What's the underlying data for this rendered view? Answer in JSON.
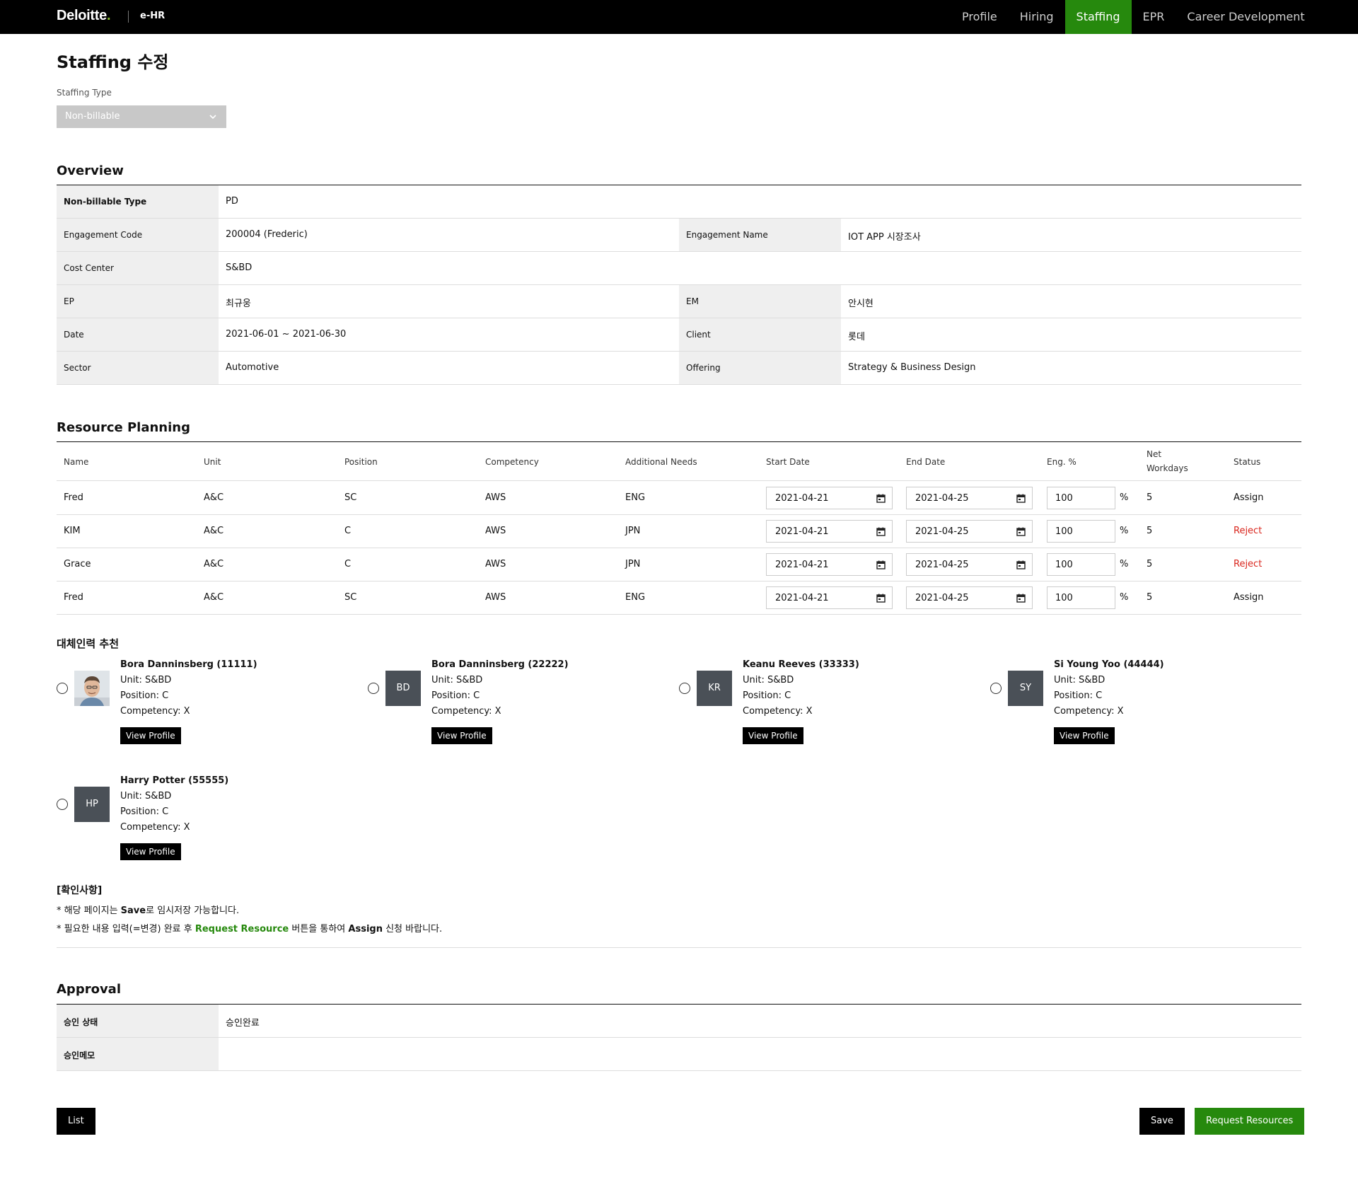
{
  "header": {
    "brand": "Deloitte",
    "brand_dot": ".",
    "sub": "e-HR",
    "nav": [
      "Profile",
      "Hiring",
      "Staffing",
      "EPR",
      "Career Development"
    ],
    "active_nav": "Staffing",
    "colors": {
      "topbar": "#000000",
      "accent": "#26890d",
      "logo_dot": "#86bc25"
    }
  },
  "page": {
    "title": "Staffing 수정",
    "staffing_type_label": "Staffing Type",
    "staffing_type_value": "Non-billable"
  },
  "overview": {
    "title": "Overview",
    "non_billable_type_label": "Non-billable Type",
    "non_billable_type_value": "PD",
    "engagement_code_label": "Engagement Code",
    "engagement_code_value": "200004 (Frederic)",
    "engagement_name_label": "Engagement Name",
    "engagement_name_value": "IOT APP 시장조사",
    "cost_center_label": "Cost Center",
    "cost_center_value": "S&BD",
    "ep_label": "EP",
    "ep_value": "최규웅",
    "em_label": "EM",
    "em_value": "안시현",
    "date_label": "Date",
    "date_value": "2021-06-01 ~ 2021-06-30",
    "client_label": "Client",
    "client_value": "롯데",
    "sector_label": "Sector",
    "sector_value": "Automotive",
    "offering_label": "Offering",
    "offering_value": "Strategy & Business Design"
  },
  "resource_planning": {
    "title": "Resource Planning",
    "columns": {
      "name": "Name",
      "unit": "Unit",
      "position": "Position",
      "competency": "Competency",
      "additional_needs": "Additional Needs",
      "start_date": "Start Date",
      "end_date": "End Date",
      "eng_pct": "Eng. %",
      "net_workdays_1": "Net",
      "net_workdays_2": "Workdays",
      "status": "Status"
    },
    "pct_suffix": "%",
    "rows": [
      {
        "name": "Fred",
        "unit": "A&C",
        "position": "SC",
        "competency": "AWS",
        "additional_needs": "ENG",
        "start_date": "2021-04-21",
        "end_date": "2021-04-25",
        "eng_pct": "100",
        "net_workdays": "5",
        "status": "Assign"
      },
      {
        "name": "KIM",
        "unit": "A&C",
        "position": "C",
        "competency": "AWS",
        "additional_needs": "JPN",
        "start_date": "2021-04-21",
        "end_date": "2021-04-25",
        "eng_pct": "100",
        "net_workdays": "5",
        "status": "Reject"
      },
      {
        "name": "Grace",
        "unit": "A&C",
        "position": "C",
        "competency": "AWS",
        "additional_needs": "JPN",
        "start_date": "2021-04-21",
        "end_date": "2021-04-25",
        "eng_pct": "100",
        "net_workdays": "5",
        "status": "Reject"
      },
      {
        "name": "Fred",
        "unit": "A&C",
        "position": "SC",
        "competency": "AWS",
        "additional_needs": "ENG",
        "start_date": "2021-04-21",
        "end_date": "2021-04-25",
        "eng_pct": "100",
        "net_workdays": "5",
        "status": "Assign"
      }
    ],
    "status_colors": {
      "Reject": "#d9251c"
    }
  },
  "recommendations": {
    "title": "대체인력 추천",
    "view_profile_label": "View Profile",
    "items": [
      {
        "name": "Bora Danninsberg (11111)",
        "initials": "",
        "unit": "Unit: S&BD",
        "position": "Position: C",
        "competency": "Competency: X"
      },
      {
        "name": "Bora Danninsberg (22222)",
        "initials": "BD",
        "unit": "Unit: S&BD",
        "position": "Position: C",
        "competency": "Competency: X"
      },
      {
        "name": "Keanu Reeves (33333)",
        "initials": "KR",
        "unit": "Unit: S&BD",
        "position": "Position: C",
        "competency": "Competency: X"
      },
      {
        "name": "Si Young Yoo (44444)",
        "initials": "SY",
        "unit": "Unit: S&BD",
        "position": "Position: C",
        "competency": "Competency: X"
      },
      {
        "name": "Harry Potter (55555)",
        "initials": "HP",
        "unit": "Unit: S&BD",
        "position": "Position: C",
        "competency": "Competency: X"
      }
    ]
  },
  "notice": {
    "title": "[확인사항]",
    "line1_pre": "* 해당 페이지는 ",
    "line1_bold": "Save",
    "line1_post": "로 임시저장 가능합니다.",
    "line2_pre": "* 필요한 내용 입력(=변경) 완료 후 ",
    "line2_green": "Request Resource",
    "line2_mid": " 버튼을 통하여 ",
    "line2_bold": "Assign",
    "line2_post": " 신청 바랍니다."
  },
  "approval": {
    "title": "Approval",
    "status_label": "승인 상태",
    "status_value": "승인완료",
    "memo_label": "승인메모",
    "memo_value": ""
  },
  "buttons": {
    "list": "List",
    "save": "Save",
    "request": "Request Resources"
  }
}
